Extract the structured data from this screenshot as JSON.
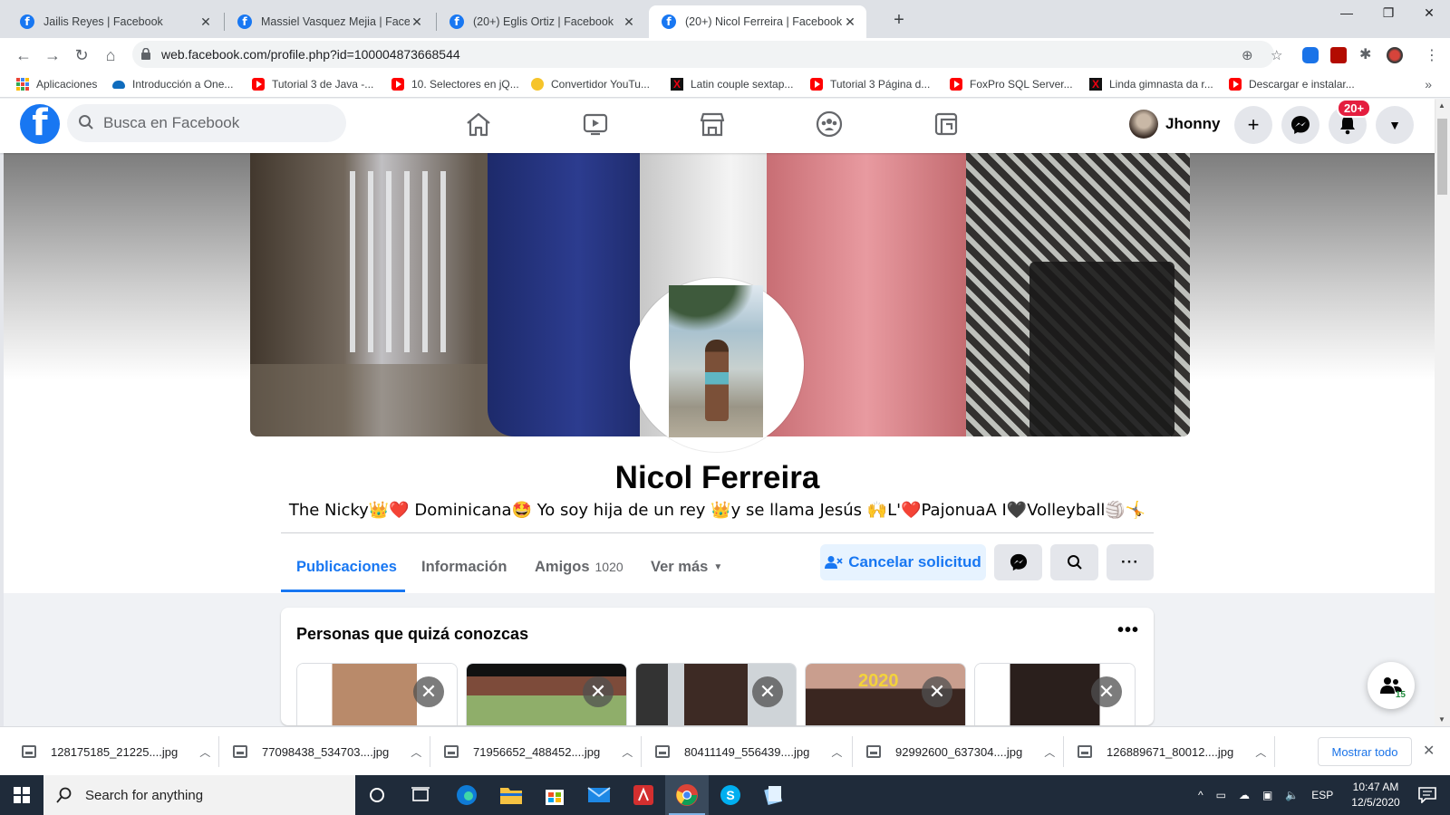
{
  "browser": {
    "tabs": [
      {
        "title": "Jailis Reyes | Facebook",
        "active": false
      },
      {
        "title": "Massiel Vasquez Mejia | Facebook",
        "active": false
      },
      {
        "title": "(20+) Eglis Ortiz | Facebook",
        "active": false
      },
      {
        "title": "(20+) Nicol Ferreira | Facebook",
        "active": true
      }
    ],
    "url": "web.facebook.com/profile.php?id=100004873668544",
    "bookmarks": [
      {
        "label": "Aplicaciones",
        "icon": "apps-grid-icon"
      },
      {
        "label": "Introducción a One...",
        "icon": "onedrive-icon"
      },
      {
        "label": "Tutorial 3 de Java -...",
        "icon": "youtube-icon"
      },
      {
        "label": "10. Selectores en jQ...",
        "icon": "youtube-icon"
      },
      {
        "label": "Convertidor YouTu...",
        "icon": "converter-icon"
      },
      {
        "label": "Latin couple sextap...",
        "icon": "x-site-icon"
      },
      {
        "label": "Tutorial 3 Página d...",
        "icon": "youtube-icon"
      },
      {
        "label": "FoxPro SQL Server...",
        "icon": "youtube-icon"
      },
      {
        "label": "Linda gimnasta da r...",
        "icon": "x-site-icon"
      },
      {
        "label": "Descargar e instalar...",
        "icon": "youtube-icon"
      }
    ]
  },
  "facebook": {
    "search_placeholder": "Busca en Facebook",
    "user_name": "Jhonny",
    "notification_badge": "20+",
    "profile": {
      "name": "Nicol Ferreira",
      "bio": "The Nicky👑❤️ Dominicana🤩 Yo soy hija de un rey 👑y se llama Jesús 🙌L'❤️PajonuaA I🖤Volleyball🏐🤸",
      "tabs": [
        {
          "label": "Publicaciones",
          "count": ""
        },
        {
          "label": "Información",
          "count": ""
        },
        {
          "label": "Amigos",
          "count": "1020"
        },
        {
          "label": "Ver más",
          "count": ""
        }
      ],
      "cancel_request_label": "Cancelar solicitud"
    },
    "pymk": {
      "title": "Personas que quizá conozcas",
      "card_overlay_text": "2020"
    },
    "chat_count": "15"
  },
  "downloads": {
    "files": [
      "128175185_21225....jpg",
      "77098438_534703....jpg",
      "71956652_488452....jpg",
      "80411149_556439....jpg",
      "92992600_637304....jpg",
      "126889671_80012....jpg"
    ],
    "show_all_label": "Mostrar todo"
  },
  "taskbar": {
    "search_placeholder": "Search for anything",
    "language": "ESP",
    "time": "10:47 AM",
    "date": "12/5/2020"
  },
  "colors": {
    "facebook_blue": "#1877f2",
    "badge_red": "#e41e3f",
    "taskbar": "#1f2b3a"
  }
}
